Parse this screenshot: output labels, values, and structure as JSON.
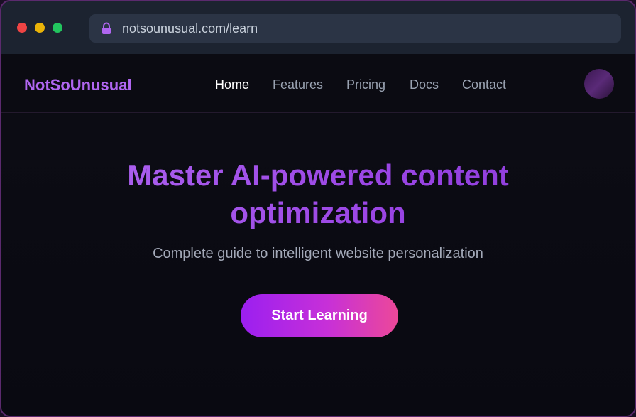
{
  "browser": {
    "url": "notsounusual.com/learn",
    "lock_icon": "lock-icon",
    "traffic_lights": [
      "#ef4444",
      "#eab308",
      "#22c55e"
    ]
  },
  "nav": {
    "brand": "NotSoUnusual",
    "links": [
      {
        "label": "Home",
        "active": true
      },
      {
        "label": "Features",
        "active": false
      },
      {
        "label": "Pricing",
        "active": false
      },
      {
        "label": "Docs",
        "active": false
      },
      {
        "label": "Contact",
        "active": false
      }
    ],
    "avatar_icon": "user-avatar"
  },
  "hero": {
    "headline_line1": "Master AI-powered content",
    "headline_line2": "optimization",
    "subtitle": "Complete guide to intelligent website personalization",
    "cta_label": "Start Learning"
  },
  "colors": {
    "accent": "#a855f7",
    "cta_start": "#9b1ff0",
    "cta_end": "#ec4899",
    "background": "#0b0b13"
  }
}
